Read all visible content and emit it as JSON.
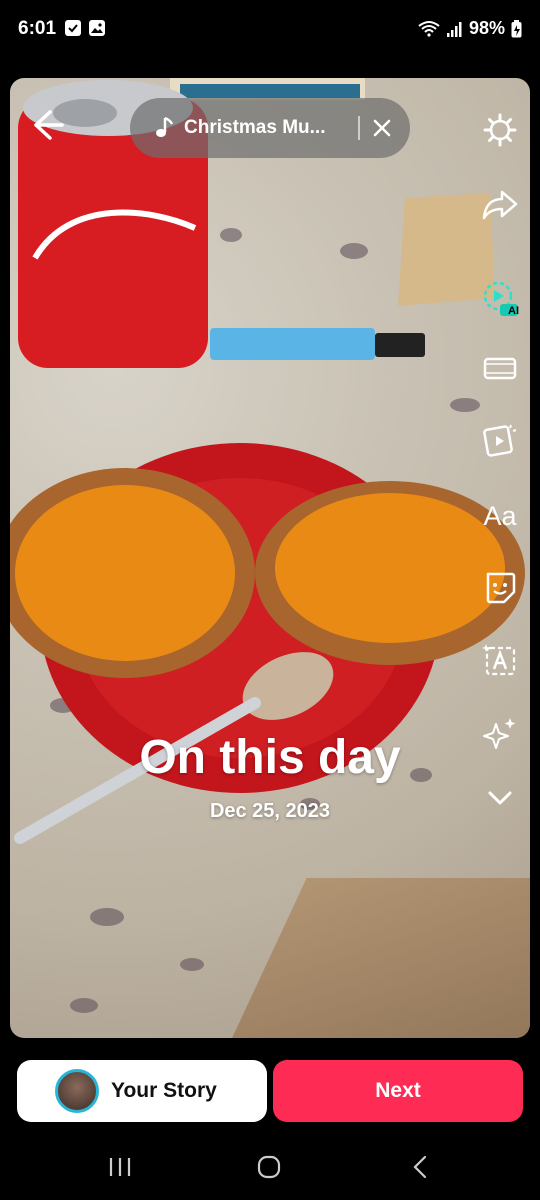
{
  "status_bar": {
    "time": "6:01",
    "battery": "98%"
  },
  "music": {
    "title": "Christmas Mu..."
  },
  "side_tools": {
    "aa_label": "Aa",
    "ai_badge": "AI"
  },
  "caption": {
    "title": "On this day",
    "date": "Dec 25, 2023"
  },
  "actions": {
    "your_story_label": "Your Story",
    "next_label": "Next"
  },
  "colors": {
    "next_button": "#fe2c55",
    "avatar_ring": "#29b6d6"
  }
}
